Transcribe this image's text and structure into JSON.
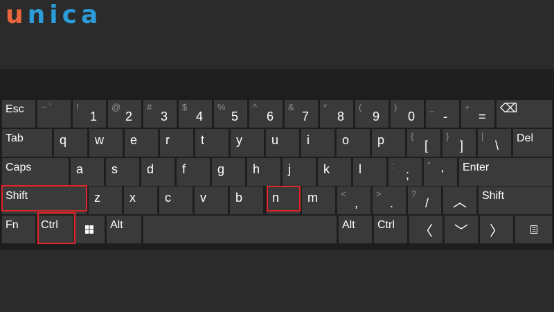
{
  "logo": {
    "first": "u",
    "rest": "nica"
  },
  "keyboard": {
    "row1": [
      {
        "sym": "",
        "main": "",
        "label": "Esc"
      },
      {
        "sym": "~ `",
        "main": "",
        "label": ""
      },
      {
        "sym": "!",
        "main": "1",
        "label": ""
      },
      {
        "sym": "@",
        "main": "2",
        "label": ""
      },
      {
        "sym": "#",
        "main": "3",
        "label": ""
      },
      {
        "sym": "$",
        "main": "4",
        "label": ""
      },
      {
        "sym": "%",
        "main": "5",
        "label": ""
      },
      {
        "sym": "^",
        "main": "6",
        "label": ""
      },
      {
        "sym": "&",
        "main": "7",
        "label": ""
      },
      {
        "sym": "*",
        "main": "8",
        "label": ""
      },
      {
        "sym": "(",
        "main": "9",
        "label": ""
      },
      {
        "sym": ")",
        "main": "0",
        "label": ""
      },
      {
        "sym": "_",
        "main": "-",
        "label": ""
      },
      {
        "sym": "+",
        "main": "=",
        "label": ""
      },
      {
        "sym": "",
        "main": "",
        "label": "⌫"
      }
    ],
    "row2": {
      "tab": "Tab",
      "letters": [
        "q",
        "w",
        "e",
        "r",
        "t",
        "y",
        "u",
        "i",
        "o",
        "p"
      ],
      "bracket_open_sym": "{",
      "bracket_open": "[",
      "bracket_close_sym": "}",
      "bracket_close": "]",
      "pipe_sym": "|",
      "backslash": "\\",
      "del": "Del"
    },
    "row3": {
      "caps": "Caps",
      "letters": [
        "a",
        "s",
        "d",
        "f",
        "g",
        "h",
        "j",
        "k",
        "l"
      ],
      "colon_sym": ":",
      "semicolon": ";",
      "quote_sym": "\"",
      "quote": "'",
      "enter": "Enter"
    },
    "row4": {
      "shift_left": "Shift",
      "letters": [
        "z",
        "x",
        "c",
        "v",
        "b",
        "n",
        "m"
      ],
      "lt_sym": "<",
      "comma": ",",
      "gt_sym": ">",
      "period": ".",
      "q_sym": "?",
      "slash": "/",
      "up": "︿",
      "shift_right": "Shift"
    },
    "row5": {
      "fn": "Fn",
      "ctrl_left": "Ctrl",
      "alt_left": "Alt",
      "alt_right": "Alt",
      "ctrl_right": "Ctrl",
      "left": "〈",
      "down": "﹀",
      "right": "〉"
    }
  },
  "highlight_color": "#e0262a"
}
